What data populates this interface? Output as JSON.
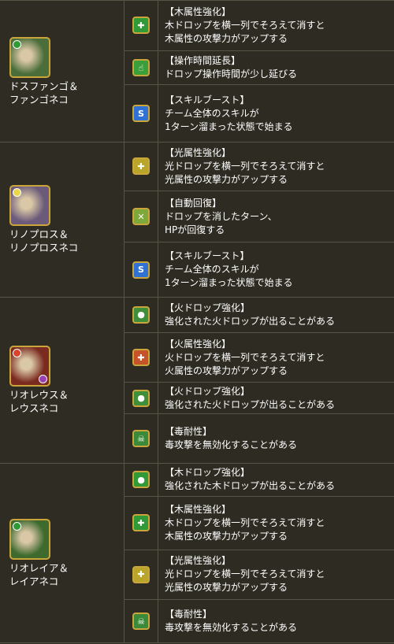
{
  "colors": {
    "background": "#2e2b22",
    "border": "#5a5447",
    "icon_frame": "#c9a53c",
    "wood": "#2f9a36",
    "light": "#e8d84a",
    "fire": "#d8452a",
    "skill_blue": "#2f72d4",
    "poison": "#9b3fb3"
  },
  "groups": [
    {
      "monster": {
        "name": "ドスファンゴ＆\nファンゴネコ",
        "portrait_icon": "dosfango-portrait-icon",
        "attr_orb": "wood",
        "frame_bg": "#4a6d3a"
      },
      "awakenings": [
        {
          "icon": "wood-attribute-enhance-icon",
          "icon_glyph": "✚",
          "icon_bg": "#2f9a36",
          "title": "【木属性強化】",
          "desc": "木ドロップを横一列でそろえて消すと\n木属性の攻撃力がアップする"
        },
        {
          "icon": "extend-time-icon",
          "icon_glyph": "☝",
          "icon_bg": "#3a9e3a",
          "title": "【操作時間延長】",
          "desc": "ドロップ操作時間が少し延びる"
        },
        {
          "icon": "skill-boost-icon",
          "icon_glyph": "S",
          "icon_bg": "#2f72d4",
          "title": "【スキルブースト】",
          "desc": "チーム全体のスキルが\n1ターン溜まった状態で始まる"
        }
      ]
    },
    {
      "monster": {
        "name": "リノプロス＆\nリノプロスネコ",
        "portrait_icon": "rhinopros-portrait-icon",
        "attr_orb": "light",
        "frame_bg": "#6b5a7a"
      },
      "awakenings": [
        {
          "icon": "light-attribute-enhance-icon",
          "icon_glyph": "✚",
          "icon_bg": "#b8a52a",
          "title": "【光属性強化】",
          "desc": "光ドロップを横一列でそろえて消すと\n光属性の攻撃力がアップする"
        },
        {
          "icon": "auto-recover-icon",
          "icon_glyph": "✕",
          "icon_bg": "#7fa83a",
          "title": "【自動回復】",
          "desc": "ドロップを消したターン、\nHPが回復する"
        },
        {
          "icon": "skill-boost-icon",
          "icon_glyph": "S",
          "icon_bg": "#2f72d4",
          "title": "【スキルブースト】",
          "desc": "チーム全体のスキルが\n1ターン溜まった状態で始まる"
        }
      ]
    },
    {
      "monster": {
        "name": "リオレウス＆\nレウスネコ",
        "portrait_icon": "rathalos-portrait-icon",
        "attr_orb": "fire",
        "frame_bg": "#7a2a1e"
      },
      "awakenings": [
        {
          "icon": "fire-orb-enhance-icon",
          "icon_glyph": "●",
          "icon_bg": "#3f8f3a",
          "title": "【火ドロップ強化】",
          "desc": "強化された火ドロップが出ることがある"
        },
        {
          "icon": "fire-attribute-enhance-icon",
          "icon_glyph": "✚",
          "icon_bg": "#c4532a",
          "title": "【火属性強化】",
          "desc": "火ドロップを横一列でそろえて消すと\n火属性の攻撃力がアップする"
        },
        {
          "icon": "fire-orb-enhance-icon",
          "icon_glyph": "●",
          "icon_bg": "#3f8f3a",
          "title": "【火ドロップ強化】",
          "desc": "強化された火ドロップが出ることがある"
        },
        {
          "icon": "poison-resist-icon",
          "icon_glyph": "☠",
          "icon_bg": "#3a8a3a",
          "title": "【毒耐性】",
          "desc": "毒攻撃を無効化することがある"
        }
      ]
    },
    {
      "monster": {
        "name": "リオレイア＆\nレイアネコ",
        "portrait_icon": "rathian-portrait-icon",
        "attr_orb": "wood",
        "frame_bg": "#3f6a2e"
      },
      "awakenings": [
        {
          "icon": "wood-orb-enhance-icon",
          "icon_glyph": "●",
          "icon_bg": "#2f9a36",
          "title": "【木ドロップ強化】",
          "desc": "強化された木ドロップが出ることがある"
        },
        {
          "icon": "wood-attribute-enhance-icon",
          "icon_glyph": "✚",
          "icon_bg": "#2f9a36",
          "title": "【木属性強化】",
          "desc": "木ドロップを横一列でそろえて消すと\n木属性の攻撃力がアップする"
        },
        {
          "icon": "light-attribute-enhance-icon",
          "icon_glyph": "✚",
          "icon_bg": "#b8a52a",
          "title": "【光属性強化】",
          "desc": "光ドロップを横一列でそろえて消すと\n光属性の攻撃力がアップする"
        },
        {
          "icon": "poison-resist-icon",
          "icon_glyph": "☠",
          "icon_bg": "#3a8a3a",
          "title": "【毒耐性】",
          "desc": "毒攻撃を無効化することがある"
        }
      ]
    }
  ]
}
